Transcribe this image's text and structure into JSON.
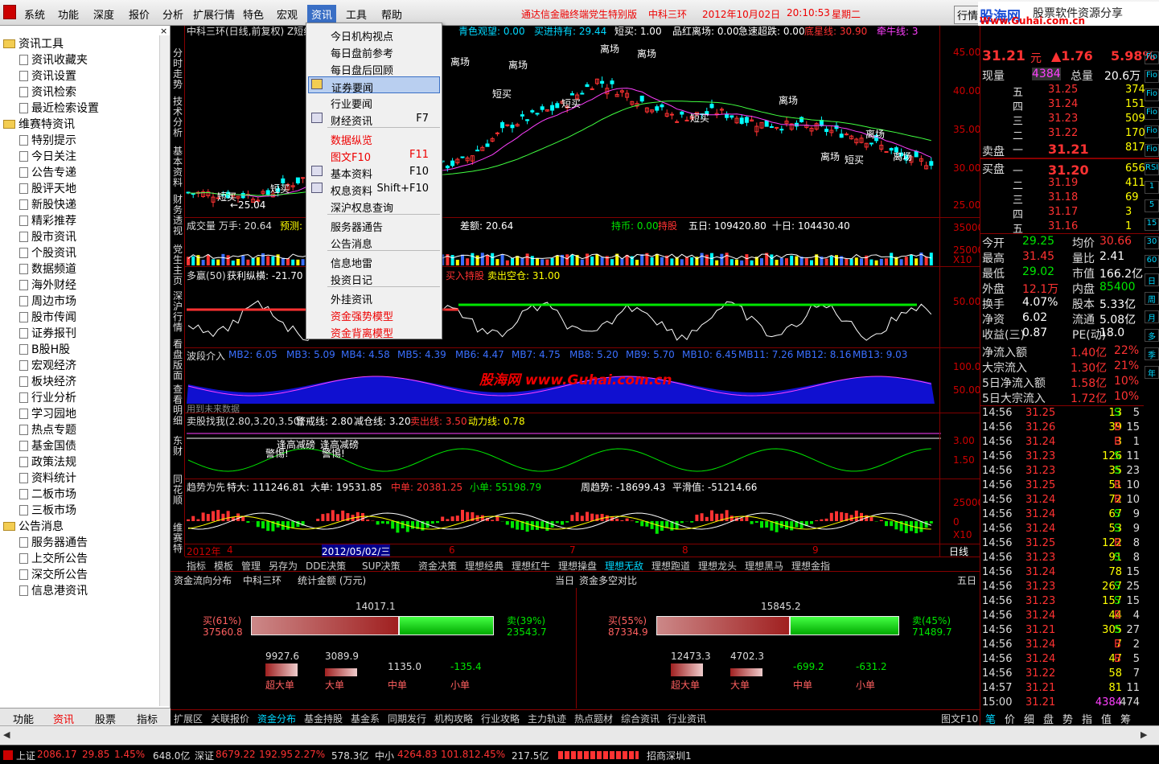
{
  "menubar": {
    "items": [
      "系统",
      "功能",
      "深度",
      "报价",
      "分析",
      "扩展行情",
      "特色",
      "宏观",
      "资讯",
      "工具",
      "帮助"
    ],
    "headline": "通达信金融终端党生特别版",
    "stock": "中科三环",
    "date": "2012年10月02日",
    "time": "20:10:53",
    "weekday": "星期二",
    "hq_button": "行情",
    "logo_main": "股海网",
    "logo_sub": "股票软件资源分享",
    "logo_url": "Www.Guhai.com.cn"
  },
  "sidebar": {
    "groups": [
      {
        "title": "资讯工具",
        "items": [
          "资讯收藏夹",
          "资讯设置",
          "资讯检索",
          "最近检索设置"
        ]
      },
      {
        "title": "维赛特资讯",
        "items": [
          "特别提示",
          "今日关注",
          "公告专递",
          "股评天地",
          "新股快递",
          "精彩推荐",
          "股市资讯",
          "个股资讯",
          "数据频道",
          "海外财经",
          "周边市场",
          "股市传闻",
          "证券报刊",
          "B股H股",
          "宏观经济",
          "板块经济",
          "行业分析",
          "学习园地",
          "热点专题",
          "基金国债",
          "政策法规",
          "资料统计",
          "二板市场",
          "三板市场"
        ]
      },
      {
        "title": "公告消息",
        "items": [
          "服务器通告",
          "上交所公告",
          "深交所公告",
          "信息港资讯"
        ]
      }
    ],
    "tabs": [
      "功能",
      "资讯",
      "股票",
      "指标"
    ]
  },
  "vtabs": [
    "分时走势",
    "技术分析",
    "基本资料",
    "财务透视",
    "党生主页",
    "深沪行情",
    "看盘版面",
    "查看明细",
    "东财",
    "同花顺",
    "维赛特"
  ],
  "dropdown": {
    "items": [
      {
        "label": "今日机构视点",
        "key": "",
        "red": false
      },
      {
        "label": "每日盘前参考",
        "key": "",
        "red": false
      },
      {
        "label": "每日盘后回顾",
        "key": "",
        "red": false
      },
      {
        "label": "证券要闻",
        "key": "",
        "red": false,
        "selected": true
      },
      {
        "label": "行业要闻",
        "key": "",
        "red": false
      },
      {
        "label": "财经资讯",
        "key": "F7",
        "red": false
      },
      {
        "label": "数据纵览",
        "key": "",
        "red": true
      },
      {
        "label": "图文F10",
        "key": "F11",
        "red": true
      },
      {
        "label": "基本资料",
        "key": "F10",
        "red": false
      },
      {
        "label": "权息资料",
        "key": "Shift+F10",
        "red": false
      },
      {
        "label": "深沪权息查询",
        "key": "",
        "red": false
      },
      {
        "label": "服务器通告",
        "key": "",
        "red": false
      },
      {
        "label": "公告消息",
        "key": "",
        "red": false
      },
      {
        "label": "信息地雷",
        "key": "",
        "red": false
      },
      {
        "label": "投资日记",
        "key": "",
        "red": false
      },
      {
        "label": "外挂资讯",
        "key": "",
        "red": false
      },
      {
        "label": "资金强势模型",
        "key": "",
        "red": true
      },
      {
        "label": "资金背离模型",
        "key": "",
        "red": true
      }
    ]
  },
  "chart": {
    "main_title": "中科三环(日线,前复权) Z短线",
    "main_ind": [
      "青色观望: 0.00",
      "买进持有: 29.44",
      "短买: 1.00",
      "品红离场: 0.00",
      "急速超跌: 0.00",
      "底星线: 30.90",
      "牵牛线: 3"
    ],
    "vol_title": "成交量 万手: 20.64",
    "vol_ind": [
      "预测:",
      "4",
      "差额: 20.64",
      "持币: 0.00",
      "持股",
      "五日: 109420.80",
      "十日: 104430.40"
    ],
    "dw_title": "多赢(50)",
    "dw_ind": [
      "获利纵横: -21.70",
      "买入持股",
      "卖出空仓: 31.00"
    ],
    "bd_title": "波段介入",
    "bd_ind": [
      "MB2: 6.05",
      "MB3: 5.09",
      "MB4: 4.58",
      "MB5: 4.39",
      "MB6: 4.47",
      "MB7: 4.75",
      "MB8: 5.20",
      "MB9: 5.70",
      "MB10: 6.45",
      "MB11: 7.26",
      "MB12: 8.16",
      "MB13: 9.03"
    ],
    "bd_note": "用到未来数据",
    "mc_title": "卖股找我(2.80,3.20,3.50)",
    "mc_ind": [
      "警戒线: 2.80",
      "减仓线: 3.20",
      "卖出线: 3.50",
      "动力线: 0.78"
    ],
    "qs_title": "趋势为先",
    "qs_ind": [
      "特大: 111246.81",
      "大单: 19531.85",
      "中单: 20381.25",
      "小单: 55198.79",
      "周趋势: -18699.43",
      "平滑值: -51214.66"
    ],
    "y_main": [
      "45.00",
      "40.00",
      "35.00",
      "30.00",
      "25.00"
    ],
    "y_vol": [
      "35000",
      "25000",
      "X10"
    ],
    "y_dw": [
      "50.00"
    ],
    "y_bd": [
      "100.0",
      "50.00"
    ],
    "y_mc": [
      "3.00",
      "1.50"
    ],
    "y_qs": [
      "25000",
      "0",
      "X10"
    ],
    "annot": [
      "离场",
      "离场",
      "离场",
      "离场",
      "离场",
      "离场",
      "离场",
      "离场",
      "短买",
      "短买",
      "短买",
      "短买",
      "短买",
      "短买",
      "←25.04",
      "逢高减磅",
      "逢高减磅",
      "警惕!",
      "警惕!"
    ],
    "watermark": "股海网 www.Guhai.com.cn",
    "xaxis": [
      "2012年",
      "4",
      "2012/05/02/三",
      "6",
      "7",
      "8",
      "9"
    ],
    "period": "日线",
    "tabs": [
      "指标",
      "模板",
      "管理",
      "另存为",
      "DDE决策",
      "SUP决策",
      "资金决策",
      "理想经典",
      "理想红牛",
      "理想操盘",
      "理想无敌",
      "理想跑道",
      "理想龙头",
      "理想黑马",
      "理想金指"
    ]
  },
  "panel": {
    "title": "资金流向分布",
    "stock": "中科三环",
    "unit": "统计金额 (万元)",
    "left_period": "当日",
    "right_title": "资金多空对比",
    "right_period": "五日",
    "left": {
      "total": "14017.1",
      "buy_pct": "买(61%)",
      "buy": "37560.8",
      "sell_pct": "卖(39%)",
      "sell": "23543.7",
      "vals": [
        "9927.6",
        "3089.9",
        "1135.0",
        "-135.4"
      ],
      "labels": [
        "超大单",
        "大单",
        "中单",
        "小单"
      ]
    },
    "right": {
      "total": "15845.2",
      "buy_pct": "买(55%)",
      "buy": "87334.9",
      "sell_pct": "卖(45%)",
      "sell": "71489.7",
      "vals": [
        "12473.3",
        "4702.3",
        "-699.2",
        "-631.2"
      ],
      "labels": [
        "超大单",
        "大单",
        "中单",
        "小单"
      ]
    }
  },
  "bottabs": [
    "扩展区",
    "关联报价",
    "资金分布",
    "基金持股",
    "基金系",
    "同期发行",
    "机构攻略",
    "行业攻略",
    "主力轨迹",
    "热点题材",
    "综合资讯",
    "行业资讯"
  ],
  "f10": "图文F10",
  "quote": {
    "price": "31.21",
    "unit": "元",
    "chg": "▲1.76",
    "pct": "5.98%",
    "xl_label": "现量",
    "xl": "4384",
    "zl_label": "总量",
    "zl": "20.6万",
    "asks": [
      [
        "五",
        "31.25",
        "374"
      ],
      [
        "四",
        "31.24",
        "151"
      ],
      [
        "三",
        "31.23",
        "509"
      ],
      [
        "二",
        "31.22",
        "170"
      ],
      [
        "一",
        "31.21",
        "817"
      ]
    ],
    "bids": [
      [
        "一",
        "31.20",
        "656"
      ],
      [
        "二",
        "31.19",
        "411"
      ],
      [
        "三",
        "31.18",
        "69"
      ],
      [
        "四",
        "31.17",
        "3"
      ],
      [
        "五",
        "31.16",
        "1"
      ]
    ],
    "sell_label": "卖盘",
    "buy_label": "买盘",
    "stats": [
      [
        "今开",
        "29.25",
        "均价",
        "30.66"
      ],
      [
        "最高",
        "31.45",
        "量比",
        "2.41"
      ],
      [
        "最低",
        "29.02",
        "市值",
        "166.2亿"
      ],
      [
        "外盘",
        "12.1万",
        "内盘",
        "85400"
      ],
      [
        "换手",
        "4.07%",
        "股本",
        "5.33亿"
      ],
      [
        "净资",
        "6.02",
        "流通",
        "5.08亿"
      ],
      [
        "收益(三)",
        "0.87",
        "PE(动)",
        "18.0"
      ]
    ],
    "flows": [
      [
        "净流入额",
        "1.40亿",
        "22%"
      ],
      [
        "大宗流入",
        "1.30亿",
        "21%"
      ],
      [
        "5日净流入额",
        "1.58亿",
        "10%"
      ],
      [
        "5日大宗流入",
        "1.72亿",
        "10%"
      ]
    ],
    "ticks": [
      [
        "14:56",
        "31.25",
        "13",
        "S",
        "5"
      ],
      [
        "14:56",
        "31.26",
        "39",
        "B",
        "15"
      ],
      [
        "14:56",
        "31.24",
        "3",
        "B",
        "1"
      ],
      [
        "14:56",
        "31.23",
        "126",
        "S",
        "11"
      ],
      [
        "14:56",
        "31.23",
        "35",
        "S",
        "23"
      ],
      [
        "14:56",
        "31.25",
        "51",
        "B",
        "10"
      ],
      [
        "14:56",
        "31.24",
        "72",
        "B",
        "10"
      ],
      [
        "14:56",
        "31.24",
        "67",
        "S",
        "9"
      ],
      [
        "14:56",
        "31.24",
        "53",
        "S",
        "9"
      ],
      [
        "14:56",
        "31.25",
        "122",
        "B",
        "8"
      ],
      [
        "14:56",
        "31.23",
        "91",
        "S",
        "8"
      ],
      [
        "14:56",
        "31.24",
        "78",
        "",
        "15"
      ],
      [
        "14:56",
        "31.23",
        "267",
        "S",
        "25"
      ],
      [
        "14:56",
        "31.23",
        "157",
        "S",
        "15"
      ],
      [
        "14:56",
        "31.24",
        "44",
        "B",
        "4"
      ],
      [
        "14:56",
        "31.21",
        "305",
        "S",
        "27"
      ],
      [
        "14:56",
        "31.24",
        "7",
        "B",
        "2"
      ],
      [
        "14:56",
        "31.24",
        "47",
        "B",
        "5"
      ],
      [
        "14:56",
        "31.22",
        "58",
        "",
        "7"
      ],
      [
        "14:57",
        "31.21",
        "81",
        "",
        "11"
      ],
      [
        "15:00",
        "31.21",
        "4384",
        "",
        "474"
      ]
    ],
    "side_btns": [
      "Fio",
      "Fio",
      "Fio",
      "Fio",
      "Fio",
      "Fio",
      "RSI",
      "1",
      "5",
      "15",
      "30",
      "60",
      "日",
      "周",
      "月",
      "多",
      "季",
      "年"
    ],
    "bottom_tabs": [
      "笔",
      "价",
      "细",
      "盘",
      "势",
      "指",
      "值",
      "筹"
    ]
  },
  "status": {
    "sh_label": "上证",
    "sh": "2086.17",
    "sh_chg": "29.85",
    "sh_pct": "1.45%",
    "sh_amt": "648.0亿",
    "sz_label": "深证",
    "sz": "8679.22",
    "sz_chg": "192.95",
    "sz_pct": "2.27%",
    "sz_amt": "578.3亿",
    "zx_label": "中小",
    "zx": "4264.83",
    "zx_chg": "101.81",
    "zx_pct": "2.45%",
    "zx_amt": "217.5亿",
    "server": "招商深圳1"
  }
}
